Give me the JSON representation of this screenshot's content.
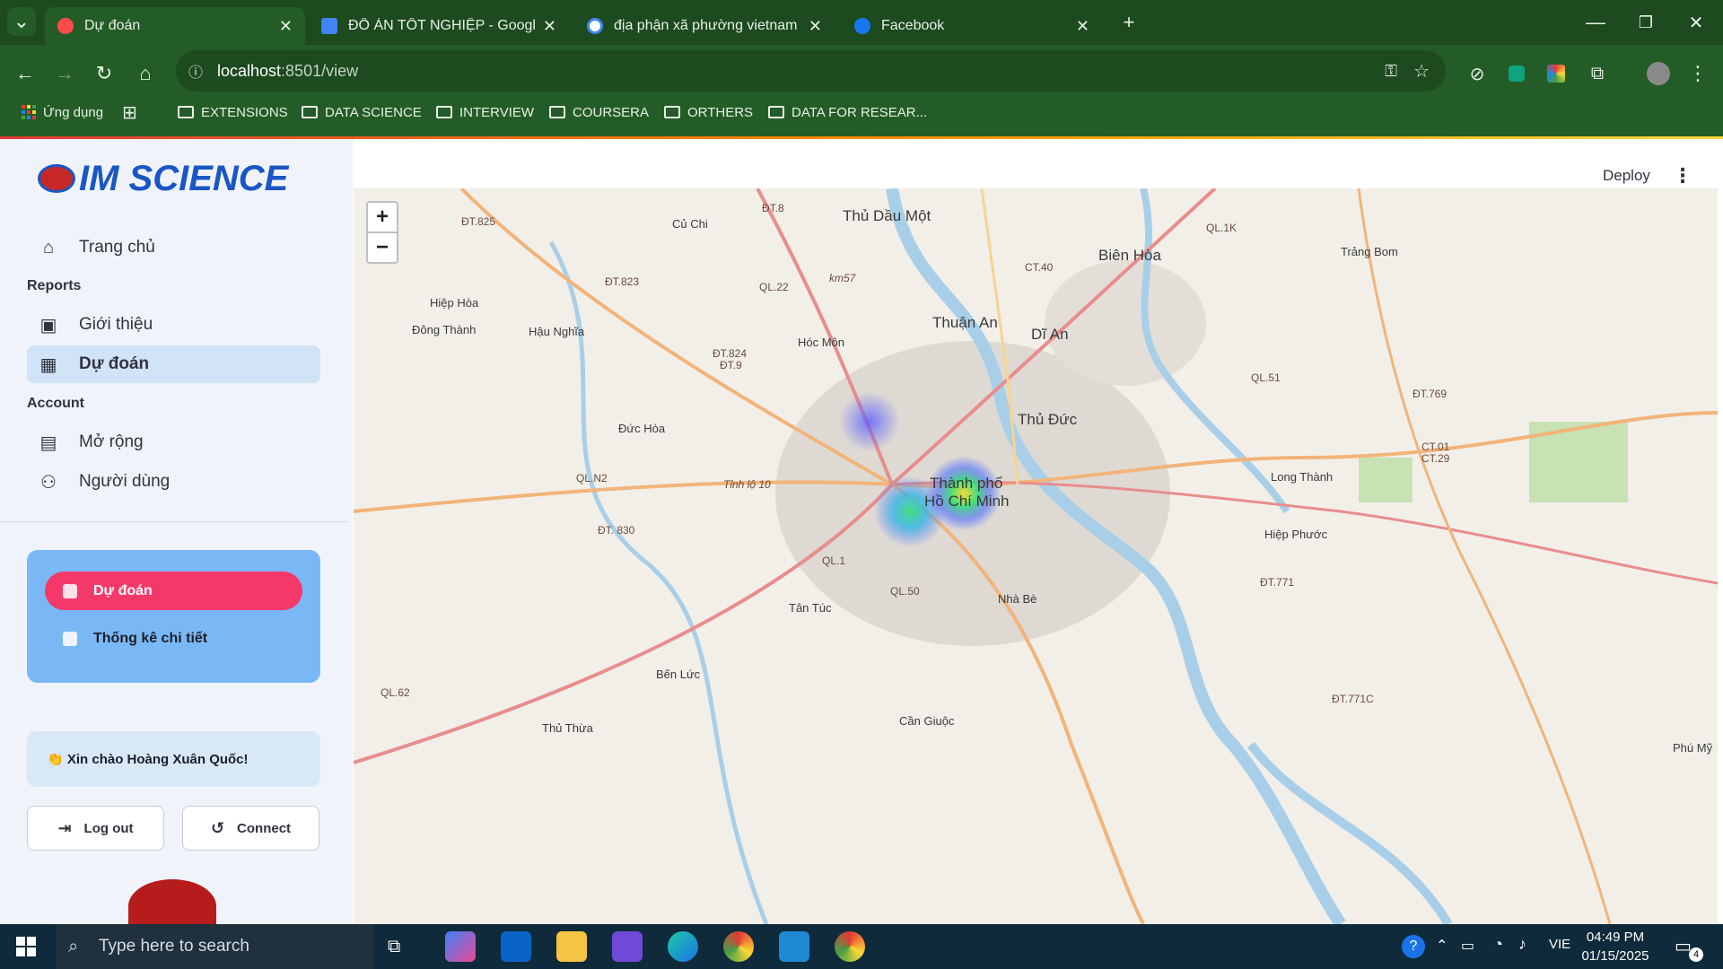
{
  "browser": {
    "tabs": [
      {
        "title": "Dự đoán",
        "icon": "streamlit-icon",
        "active": true
      },
      {
        "title": "ĐỒ ÁN TỐT NGHIỆP - Google T",
        "icon": "google-docs-icon"
      },
      {
        "title": "địa phận xã phường vietnam ge",
        "icon": "google-icon"
      },
      {
        "title": "Facebook",
        "icon": "facebook-icon"
      }
    ],
    "url_host": "localhost",
    "url_path": ":8501/view",
    "bookmarks": [
      "Ứng dụng",
      "EXTENSIONS",
      "DATA SCIENCE",
      "INTERVIEW",
      "COURSERA",
      "ORTHERS",
      "DATA FOR RESEAR..."
    ]
  },
  "sidebar": {
    "logo_text": "IM SCIENCE",
    "home_label": "Trang chủ",
    "reports_header": "Reports",
    "intro_label": "Giới thiệu",
    "predict_label": "Dự đoán",
    "account_header": "Account",
    "expand_label": "Mở rộng",
    "users_label": "Người dùng",
    "card_predict": "Dự đoán",
    "card_stats": "Thống kê chi tiết",
    "greeting": "👏 Xin chào Hoàng Xuân Quốc!",
    "logout_label": "Log out",
    "connect_label": "Connect"
  },
  "header": {
    "deploy_label": "Deploy",
    "more_icon": "⋮"
  },
  "map": {
    "zoom_in": "+",
    "zoom_out": "−",
    "places": {
      "thu_dau_mot": "Thủ Dầu Một",
      "cu_chi": "Củ Chi",
      "bien_hoa": "Biên Hòa",
      "trang_bom": "Trảng Bom",
      "thuan_an": "Thuận An",
      "di_an": "Dĩ An",
      "hiep_hoa": "Hiệp Hòa",
      "dong_thanh": "Đông Thành",
      "hau_nghia": "Hậu Nghĩa",
      "hoc_mon": "Hóc Môn",
      "thu_duc": "Thủ Đức",
      "duc_hoa": "Đức Hòa",
      "tp_hcm_1": "Thành phố",
      "tp_hcm_2": "Hồ Chí Minh",
      "long_thanh": "Long Thành",
      "hiep_phuoc": "Hiệp Phước",
      "tan_tuc": "Tân Túc",
      "nha_be": "Nhà Bè",
      "ben_luc": "Bến Lức",
      "can_giuoc": "Cần Giuộc",
      "thu_thua": "Thủ Thừa",
      "phu_my": "Phú Mỹ"
    },
    "roads": {
      "dt825": "ĐT.825",
      "dt8": "ĐT.8",
      "ql1k": "QL.1K",
      "dt823": "ĐT.823",
      "ql22": "QL.22",
      "ct40": "CT.40",
      "dt824": "ĐT.824",
      "dt9": "ĐT.9",
      "ql51": "QL.51",
      "dt769": "ĐT.769",
      "qln2": "QL.N2",
      "ct01": "CT.01",
      "ct29": "CT.29",
      "dt830": "ĐT. 830",
      "ql1": "QL.1",
      "ql50": "QL.50",
      "dt771": "ĐT.771",
      "ql62": "QL.62",
      "dt771c": "ĐT.771C",
      "tinh_lo_10": "Tỉnh lộ 10",
      "km57": "km57"
    },
    "heat_colors": {
      "hot": "#fdd835",
      "mid": "#43e07a",
      "cool": "#4f6bff"
    }
  },
  "taskbar": {
    "search_placeholder": "Type here to search",
    "language": "VIE",
    "time": "04:49 PM",
    "date": "01/15/2025",
    "notifications": "4"
  }
}
